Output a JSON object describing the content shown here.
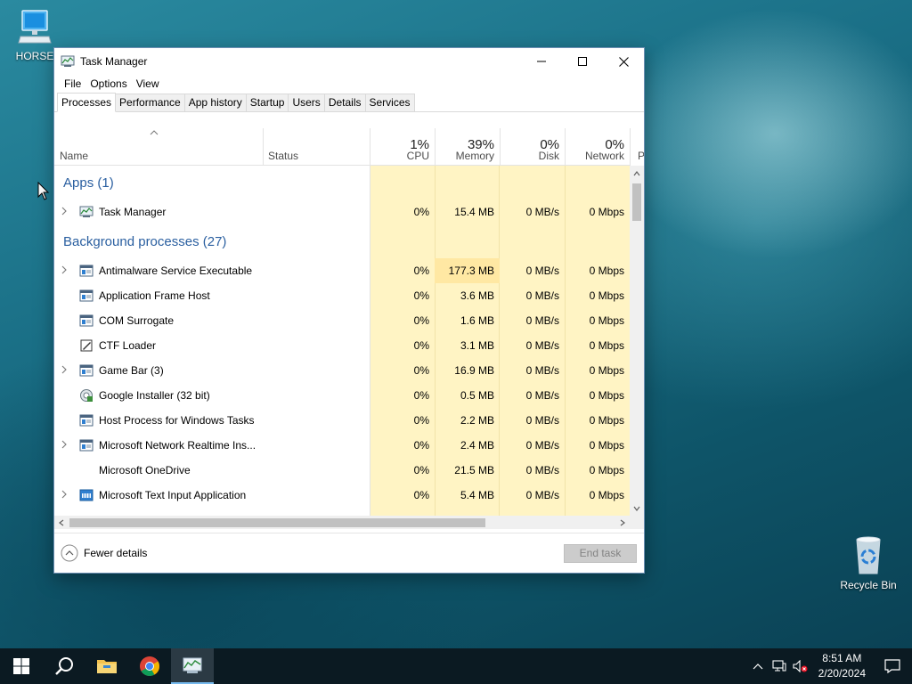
{
  "desktop": {
    "icons": [
      {
        "label": "HORSE"
      },
      {
        "label": "Recycle Bin"
      }
    ]
  },
  "window": {
    "title": "Task Manager",
    "menu": [
      "File",
      "Options",
      "View"
    ],
    "tabs": [
      "Processes",
      "Performance",
      "App history",
      "Startup",
      "Users",
      "Details",
      "Services"
    ],
    "columns": {
      "name": "Name",
      "status": "Status",
      "cpu": {
        "pct": "1%",
        "label": "CPU"
      },
      "memory": {
        "pct": "39%",
        "label": "Memory"
      },
      "disk": {
        "pct": "0%",
        "label": "Disk"
      },
      "network": {
        "pct": "0%",
        "label": "Network"
      },
      "power": "P"
    },
    "groups": {
      "apps": "Apps (1)",
      "background": "Background processes (27)"
    },
    "apps": [
      {
        "name": "Task Manager",
        "cpu": "0%",
        "memory": "15.4 MB",
        "disk": "0 MB/s",
        "network": "0 Mbps"
      }
    ],
    "background": [
      {
        "name": "Antimalware Service Executable",
        "cpu": "0%",
        "memory": "177.3 MB",
        "disk": "0 MB/s",
        "network": "0 Mbps"
      },
      {
        "name": "Application Frame Host",
        "cpu": "0%",
        "memory": "3.6 MB",
        "disk": "0 MB/s",
        "network": "0 Mbps"
      },
      {
        "name": "COM Surrogate",
        "cpu": "0%",
        "memory": "1.6 MB",
        "disk": "0 MB/s",
        "network": "0 Mbps"
      },
      {
        "name": "CTF Loader",
        "cpu": "0%",
        "memory": "3.1 MB",
        "disk": "0 MB/s",
        "network": "0 Mbps"
      },
      {
        "name": "Game Bar (3)",
        "cpu": "0%",
        "memory": "16.9 MB",
        "disk": "0 MB/s",
        "network": "0 Mbps"
      },
      {
        "name": "Google Installer (32 bit)",
        "cpu": "0%",
        "memory": "0.5 MB",
        "disk": "0 MB/s",
        "network": "0 Mbps"
      },
      {
        "name": "Host Process for Windows Tasks",
        "cpu": "0%",
        "memory": "2.2 MB",
        "disk": "0 MB/s",
        "network": "0 Mbps"
      },
      {
        "name": "Microsoft Network Realtime Ins...",
        "cpu": "0%",
        "memory": "2.4 MB",
        "disk": "0 MB/s",
        "network": "0 Mbps"
      },
      {
        "name": "Microsoft OneDrive",
        "cpu": "0%",
        "memory": "21.5 MB",
        "disk": "0 MB/s",
        "network": "0 Mbps"
      },
      {
        "name": "Microsoft Text Input Application",
        "cpu": "0%",
        "memory": "5.4 MB",
        "disk": "0 MB/s",
        "network": "0 Mbps"
      }
    ],
    "footer": {
      "fewer_details": "Fewer details",
      "end_task": "End task"
    }
  },
  "taskbar": {
    "time": "8:51 AM",
    "date": "2/20/2024"
  },
  "colors": {
    "accent_blue": "#2a5fa0",
    "heat_light": "#fff4c4",
    "heat_medium": "#ffe8a3"
  }
}
